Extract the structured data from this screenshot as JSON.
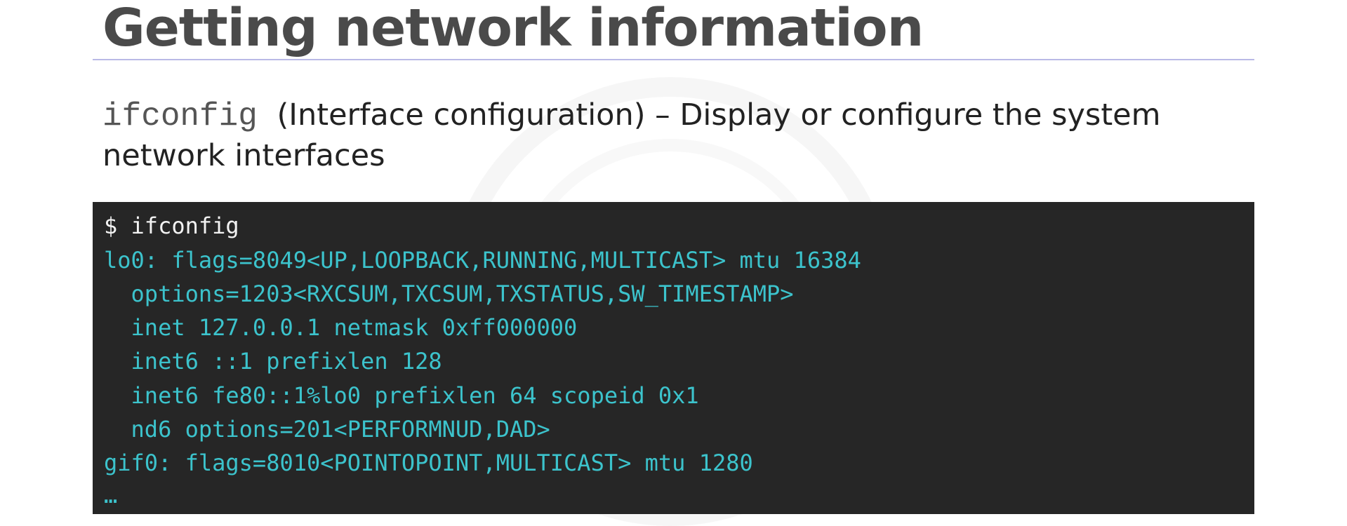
{
  "slide": {
    "title": "Getting network information",
    "subtitle": {
      "command": "ifconfig",
      "description": "(Interface configuration) – Display or configure the system network interfaces"
    }
  },
  "terminal": {
    "lines": [
      "$ ifconfig",
      "lo0: flags=8049<UP,LOOPBACK,RUNNING,MULTICAST> mtu 16384",
      "  options=1203<RXCSUM,TXCSUM,TXSTATUS,SW_TIMESTAMP>",
      "  inet 127.0.0.1 netmask 0xff000000",
      "  inet6 ::1 prefixlen 128",
      "  inet6 fe80::1%lo0 prefixlen 64 scopeid 0x1",
      "  nd6 options=201<PERFORMNUD,DAD>",
      "gif0: flags=8010<POINTOPOINT,MULTICAST> mtu 1280",
      "…"
    ],
    "colors": {
      "background": "#262626",
      "prompt": "#f2f2f2",
      "output": "#3cc3cc"
    }
  },
  "colors": {
    "title": "#4a4a4a",
    "rule": "#b9b9e6",
    "text": "#222222"
  }
}
